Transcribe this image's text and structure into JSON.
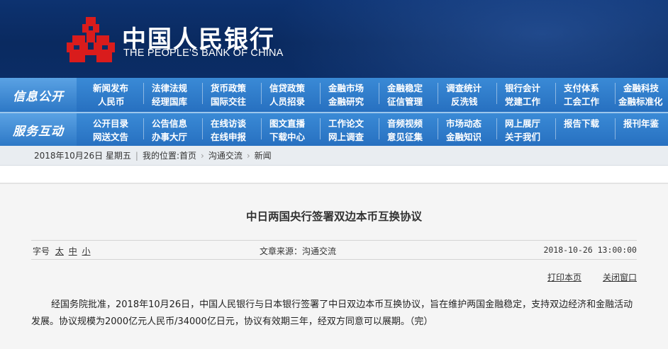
{
  "header": {
    "title_cn": "中国人民银行",
    "title_en": "THE PEOPLE'S BANK OF CHINA",
    "logo_icon": "pboc-logo-icon",
    "colors": {
      "header_bg": "#0d3270",
      "logo_red": "#d91c1c",
      "nav_blue": "#2f7cc8"
    }
  },
  "info_nav": {
    "title": "信息公开",
    "row1": [
      "新闻发布",
      "法律法规",
      "货币政策",
      "信贷政策",
      "金融市场",
      "金融稳定",
      "调查统计",
      "银行会计",
      "支付体系",
      "金融科技"
    ],
    "row2": [
      "人民币",
      "经理国库",
      "国际交往",
      "人员招录",
      "金融研究",
      "征信管理",
      "反洗钱",
      "党建工作",
      "工会工作",
      "金融标准化"
    ]
  },
  "service_nav": {
    "title": "服务互动",
    "row1": [
      "公开目录",
      "公告信息",
      "在线访谈",
      "图文直播",
      "工作论文",
      "音频视频",
      "市场动态",
      "网上展厅",
      "报告下载",
      "报刊年鉴"
    ],
    "row2": [
      "网送文告",
      "办事大厅",
      "在线申报",
      "下载中心",
      "网上调查",
      "意见征集",
      "金融知识",
      "关于我们"
    ]
  },
  "breadcrumb": {
    "date": "2018年10月26日 星期五",
    "location_label": "我的位置:",
    "home": "首页",
    "section": "沟通交流",
    "current": "新闻",
    "separator": "›"
  },
  "article": {
    "title": "中日两国央行签署双边本币互换协议",
    "font_size_label": "字号",
    "font_sizes": [
      "太",
      "中",
      "小"
    ],
    "source": "文章来源：沟通交流",
    "datetime": "2018-10-26 13:00:00",
    "print_label": "打印本页",
    "close_label": "关闭窗口",
    "body": "经国务院批准，2018年10月26日，中国人民银行与日本银行签署了中日双边本币互换协议，旨在维护两国金融稳定，支持双边经济和金融活动发展。协议规模为2000亿元人民币/34000亿日元，协议有效期三年，经双方同意可以展期。（完）"
  }
}
